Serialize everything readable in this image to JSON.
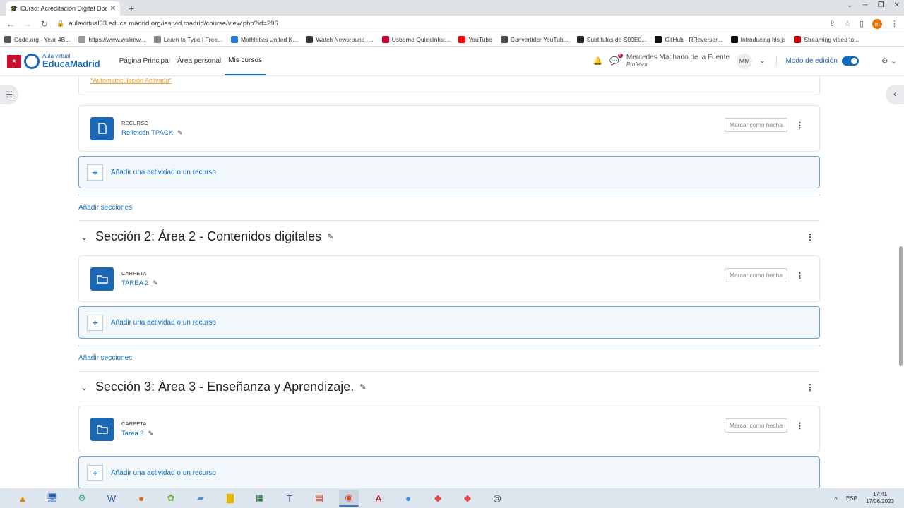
{
  "browser": {
    "tab_title": "Curso: Acreditación Digital Doce",
    "url": "aulavirtual33.educa.madrid.org/ies.vid.madrid/course/view.php?id=296",
    "profile_initial": "m",
    "bookmarks": [
      {
        "label": "Code.org - Year 4B...",
        "color": "#555"
      },
      {
        "label": "https://www.walimw...",
        "color": "#999"
      },
      {
        "label": "Learn to Type | Free...",
        "color": "#888"
      },
      {
        "label": "Mathletics United K...",
        "color": "#2a7bd1"
      },
      {
        "label": "Watch Newsround -...",
        "color": "#333"
      },
      {
        "label": "Usborne Quicklinks:...",
        "color": "#c03"
      },
      {
        "label": "YouTube",
        "color": "#f00"
      },
      {
        "label": "Convertidor YouTub...",
        "color": "#444"
      },
      {
        "label": "Subtítulos de S09E0...",
        "color": "#222"
      },
      {
        "label": "GitHub - RReverser...",
        "color": "#111"
      },
      {
        "label": "Introducing hls.js",
        "color": "#111"
      },
      {
        "label": "Streaming video to...",
        "color": "#c00"
      }
    ]
  },
  "navbar": {
    "brand_small": "Aula virtual",
    "brand_big": "EducaMadrid",
    "links": [
      "Página Principal",
      "Área personal",
      "Mis cursos"
    ],
    "active_link": "Mis cursos",
    "messages_count": "6",
    "user_name": "Mercedes Machado de la Fuente",
    "user_role": "Profesor",
    "avatar_initials": "MM",
    "edit_mode_label": "Modo de edición"
  },
  "content": {
    "autom_text": "*Automatriculación Activada*",
    "mark_label": "Marcar como hecha",
    "add_activity_label": "Añadir una actividad o un recurso",
    "add_sections_label": "Añadir secciones",
    "items": {
      "resource1": {
        "type": "RECURSO",
        "name": "Reflexión TPACK"
      },
      "folder2": {
        "type": "CARPETA",
        "name": "TAREA 2"
      },
      "folder3": {
        "type": "CARPETA",
        "name": "Tarea 3"
      }
    },
    "sections": {
      "s2": "Sección 2: Área 2 - Contenidos digitales",
      "s3": "Sección 3: Área 3 - Enseñanza y Aprendizaje."
    }
  },
  "taskbar": {
    "lang": "ESP",
    "time": "17:41",
    "date": "17/06/2023"
  }
}
